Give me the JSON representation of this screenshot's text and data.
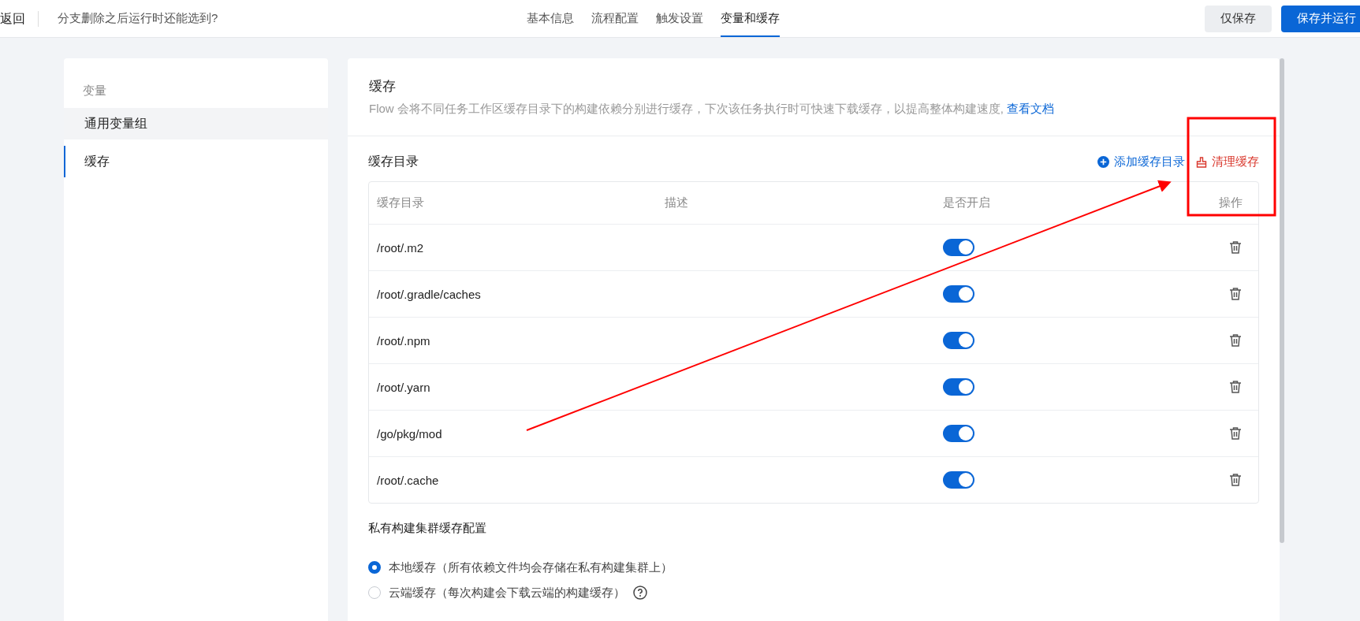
{
  "top_bar": {
    "back": "返回",
    "title": "分支删除之后运行时还能选到?",
    "tabs": [
      {
        "label": "基本信息",
        "selected": false
      },
      {
        "label": "流程配置",
        "selected": false
      },
      {
        "label": "触发设置",
        "selected": false
      },
      {
        "label": "变量和缓存",
        "selected": true
      }
    ],
    "buttons": [
      {
        "label": "仅保存",
        "kind": "secondary"
      },
      {
        "label": "保存并运行",
        "kind": "primary"
      }
    ]
  },
  "sidebar": {
    "heading": "变量",
    "items": [
      {
        "label": "通用变量组",
        "selected": false,
        "highlighted": true
      },
      {
        "label": "缓存",
        "selected": true,
        "highlighted": false
      }
    ]
  },
  "cache": {
    "title": "缓存",
    "description": "Flow 会将不同任务工作区缓存目录下的构建依赖分别进行缓存，下次该任务执行时可快速下载缓存，以提高整体构建速度, ",
    "doc_link": "查看文档",
    "section_title": "缓存目录",
    "add_button": "添加缓存目录",
    "clear_button": "清理缓存",
    "table": {
      "columns": [
        "缓存目录",
        "描述",
        "是否开启",
        "操作"
      ],
      "rows": [
        {
          "path": "/root/.m2",
          "enabled": true
        },
        {
          "path": "/root/.gradle/caches",
          "enabled": true
        },
        {
          "path": "/root/.npm",
          "enabled": true
        },
        {
          "path": "/root/.yarn",
          "enabled": true
        },
        {
          "path": "/go/pkg/mod",
          "enabled": true
        },
        {
          "path": "/root/.cache",
          "enabled": true
        }
      ]
    }
  },
  "private_cluster": {
    "title": "私有构建集群缓存配置",
    "options": [
      {
        "label": "本地缓存（所有依赖文件均会存储在私有构建集群上）",
        "selected": true,
        "help": false
      },
      {
        "label": "云端缓存（每次构建会下载云端的构建缓存）",
        "selected": false,
        "help": true
      }
    ]
  },
  "annotation": {
    "box": true,
    "arrow": true
  }
}
